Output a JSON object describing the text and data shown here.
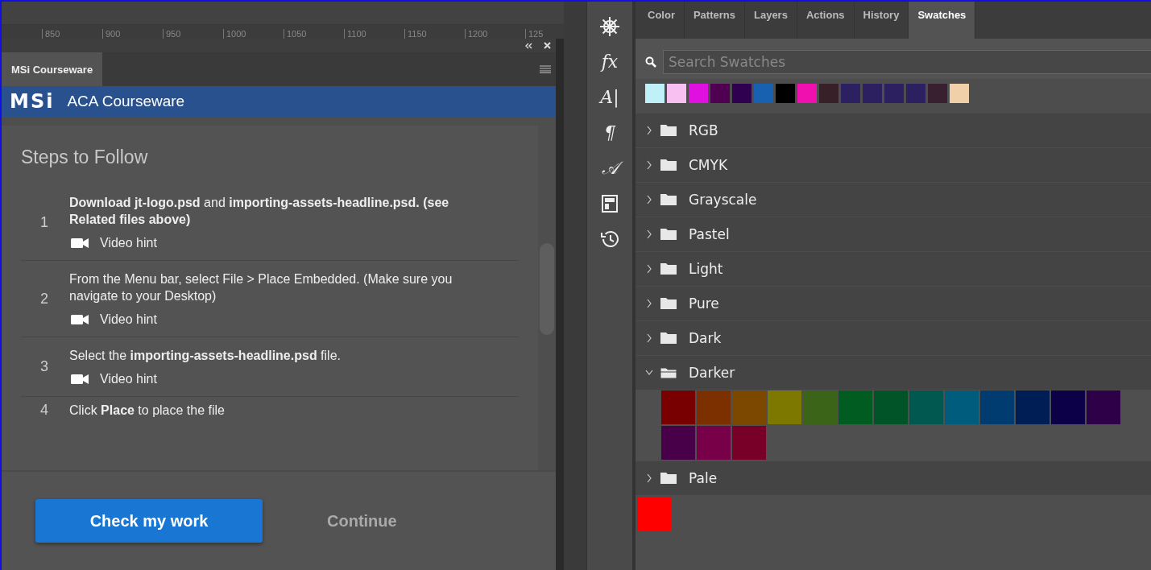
{
  "ruler": {
    "ticks": [
      "850",
      "900",
      "950",
      "1000",
      "1050",
      "1100",
      "1150",
      "1200",
      "125"
    ]
  },
  "left_panel": {
    "tab": "MSi Courseware",
    "banner": {
      "logo": "MSi",
      "title": "ACA Courseware"
    },
    "heading": "Steps to Follow",
    "steps": [
      {
        "number": "1",
        "text": "**Download jt-logo.psd** and **importing-assets-headline.psd. (see Related files above)**",
        "video_hint": "Video hint"
      },
      {
        "number": "2",
        "text": "From the Menu bar, select File > Place Embedded. (Make sure you navigate to your Desktop)",
        "video_hint": "Video hint"
      },
      {
        "number": "3",
        "text": "Select the **importing-assets-headline.psd** file.",
        "video_hint": "Video hint"
      },
      {
        "number": "4",
        "text": "Click **Place** to place the file"
      }
    ],
    "buttons": {
      "primary": "Check my work",
      "secondary": "Continue"
    }
  },
  "toolbar": [
    {
      "kind": "wheel"
    },
    {
      "kind": "glyph",
      "text": "fx"
    },
    {
      "kind": "glyph",
      "text": "A|"
    },
    {
      "kind": "glyph",
      "text": "¶"
    },
    {
      "kind": "glyph",
      "text": "𝒜"
    },
    {
      "kind": "layout"
    },
    {
      "kind": "history"
    }
  ],
  "right_panel": {
    "tabs": [
      {
        "label": "Color",
        "selected": false
      },
      {
        "label": "Patterns",
        "selected": false
      },
      {
        "label": "Layers",
        "selected": false
      },
      {
        "label": "Actions",
        "selected": false
      },
      {
        "label": "History",
        "selected": false
      },
      {
        "label": "Swatches",
        "selected": true
      }
    ],
    "search": {
      "placeholder": "Search Swatches"
    },
    "recent": [
      {
        "color": "#c0f0f8"
      },
      {
        "color": "#f8c0f0"
      },
      {
        "color": "#e010e0"
      },
      {
        "color": "#500050"
      },
      {
        "color": "#300050"
      },
      {
        "color": "#1860b0"
      },
      {
        "color": "#000000"
      },
      {
        "color": "#f010b0"
      },
      {
        "color": "#382028"
      },
      {
        "color": "#2c2060"
      },
      {
        "color": "#2c2060"
      },
      {
        "color": "#2c2060"
      },
      {
        "color": "#2c2060"
      },
      {
        "color": "#382030"
      },
      {
        "color": "#f0d0a8"
      }
    ],
    "groups": [
      {
        "name": "RGB",
        "expanded": false
      },
      {
        "name": "CMYK",
        "expanded": false
      },
      {
        "name": "Grayscale",
        "expanded": false
      },
      {
        "name": "Pastel",
        "expanded": false
      },
      {
        "name": "Light",
        "expanded": false
      },
      {
        "name": "Pure",
        "expanded": false
      },
      {
        "name": "Dark",
        "expanded": false
      },
      {
        "name": "Darker",
        "expanded": true,
        "swatches": [
          {
            "color": "#780000"
          },
          {
            "color": "#7c3000"
          },
          {
            "color": "#7c4800"
          },
          {
            "color": "#7c7800"
          },
          {
            "color": "#3c6418"
          },
          {
            "color": "#005c20"
          },
          {
            "color": "#005428"
          },
          {
            "color": "#005850"
          },
          {
            "color": "#005c7c"
          },
          {
            "color": "#003c70"
          },
          {
            "color": "#001e56"
          },
          {
            "color": "#0c0048"
          },
          {
            "color": "#2e0048"
          },
          {
            "color": "#480048"
          },
          {
            "color": "#780048"
          },
          {
            "color": "#780028"
          }
        ]
      },
      {
        "name": "Pale",
        "expanded": false
      }
    ],
    "loose": [
      {
        "color": "#ff0000"
      }
    ]
  }
}
